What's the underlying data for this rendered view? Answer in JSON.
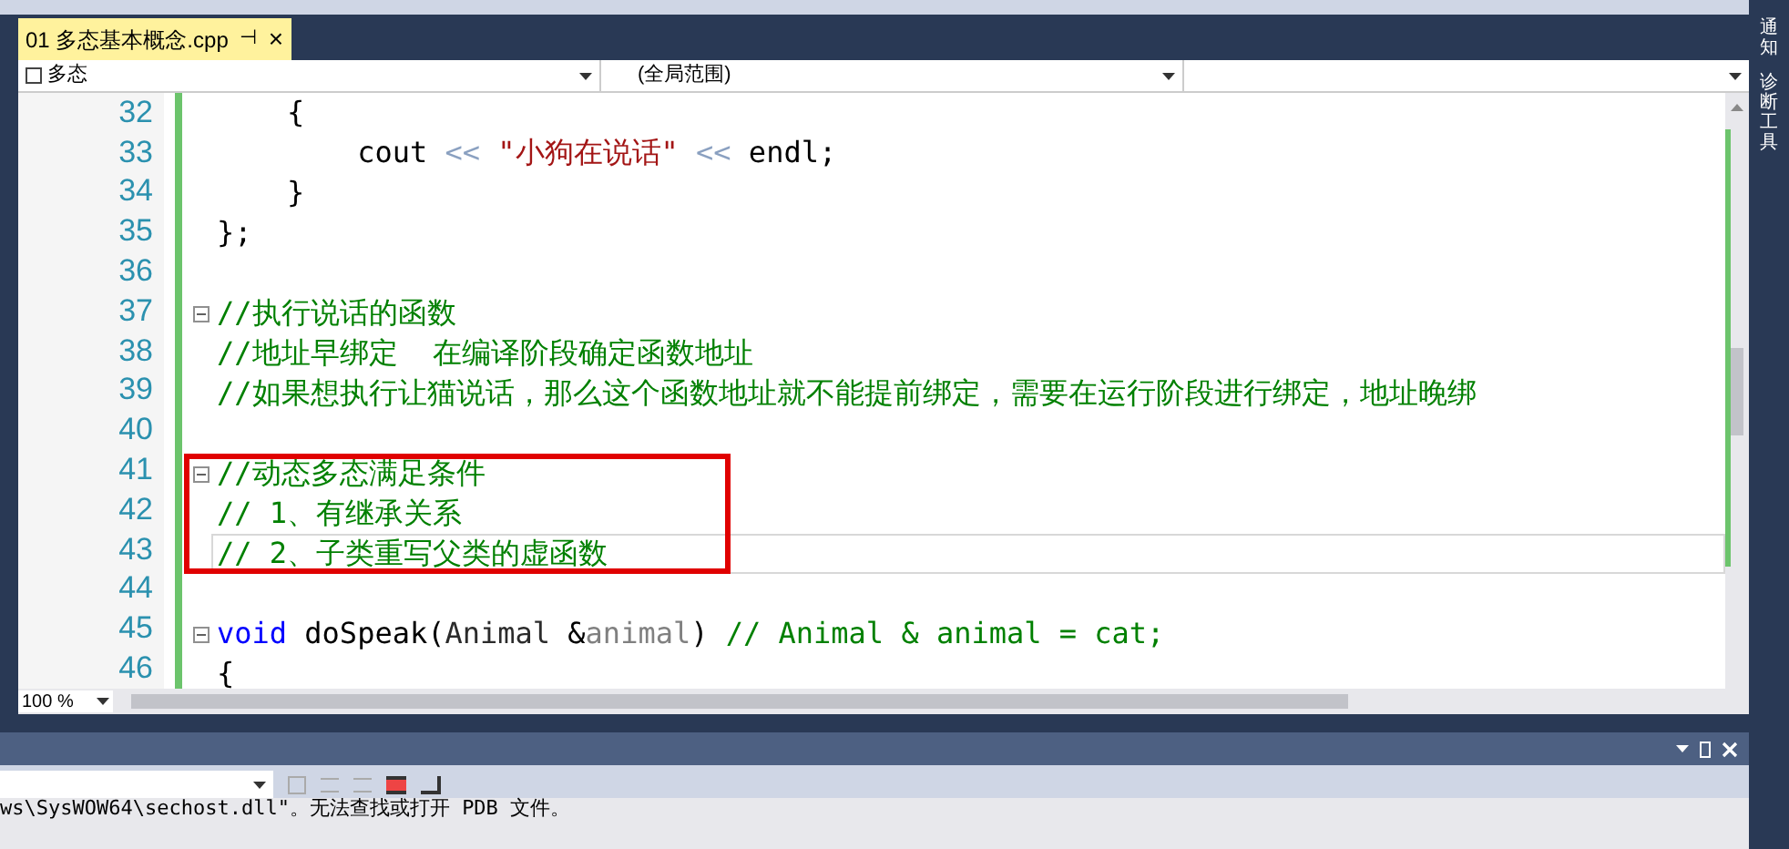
{
  "document_tab": {
    "title": "01 多态基本概念.cpp",
    "pin": "⊣",
    "close": "×",
    "selected": true
  },
  "nav_bar": {
    "scope": "多态",
    "member": "(全局范围)"
  },
  "code_lines": [
    {
      "number": "32",
      "segments": [
        {
          "kind": "plain",
          "text": "    {"
        }
      ]
    },
    {
      "number": "33",
      "segments": [
        {
          "kind": "plain",
          "text": "        cout "
        },
        {
          "kind": "operator",
          "text": "<<"
        },
        {
          "kind": "string",
          "text": " \"小狗在说话\" "
        },
        {
          "kind": "operator",
          "text": "<<"
        },
        {
          "kind": "plain",
          "text": " endl;"
        }
      ]
    },
    {
      "number": "34",
      "segments": [
        {
          "kind": "plain",
          "text": "    }"
        }
      ]
    },
    {
      "number": "35",
      "segments": [
        {
          "kind": "plain",
          "text": "};"
        }
      ]
    },
    {
      "number": "36"
    },
    {
      "number": "37",
      "fold": true,
      "segments": [
        {
          "kind": "comment",
          "text": "//执行说话的函数"
        }
      ]
    },
    {
      "number": "38",
      "segments": [
        {
          "kind": "comment",
          "text": "//地址早绑定  在编译阶段确定函数地址"
        }
      ]
    },
    {
      "number": "39",
      "segments": [
        {
          "kind": "comment",
          "text": "//如果想执行让猫说话，那么这个函数地址就不能提前绑定，需要在运行阶段进行绑定，地址晚绑"
        }
      ]
    },
    {
      "number": "40"
    },
    {
      "number": "41",
      "fold": true,
      "boxed": true,
      "segments": [
        {
          "kind": "comment",
          "text": "//动态多态满足条件"
        }
      ]
    },
    {
      "number": "42",
      "boxed": true,
      "segments": [
        {
          "kind": "comment",
          "text": "// 1、有继承关系"
        }
      ]
    },
    {
      "number": "43",
      "boxed": true,
      "current": true,
      "segments": [
        {
          "kind": "comment",
          "text": "// 2、子类重写父类的虚函数"
        }
      ]
    },
    {
      "number": "44"
    },
    {
      "number": "45",
      "fold": true,
      "segments": [
        {
          "kind": "keyword",
          "text": "void"
        },
        {
          "kind": "plain",
          "text": " doSpeak("
        },
        {
          "kind": "type",
          "text": "Animal"
        },
        {
          "kind": "plain",
          "text": " &"
        },
        {
          "kind": "param",
          "text": "animal"
        },
        {
          "kind": "plain",
          "text": ") "
        },
        {
          "kind": "comment",
          "text": "// Animal & animal = cat;"
        }
      ]
    },
    {
      "number": "46",
      "segments": [
        {
          "kind": "plain",
          "text": "{"
        }
      ]
    }
  ],
  "zoom": "100 %",
  "output_line": "ws\\SysWOW64\\sechost.dll\"。无法查找或打开 PDB 文件。",
  "side_tabs": [
    "通知",
    "诊断工具"
  ]
}
